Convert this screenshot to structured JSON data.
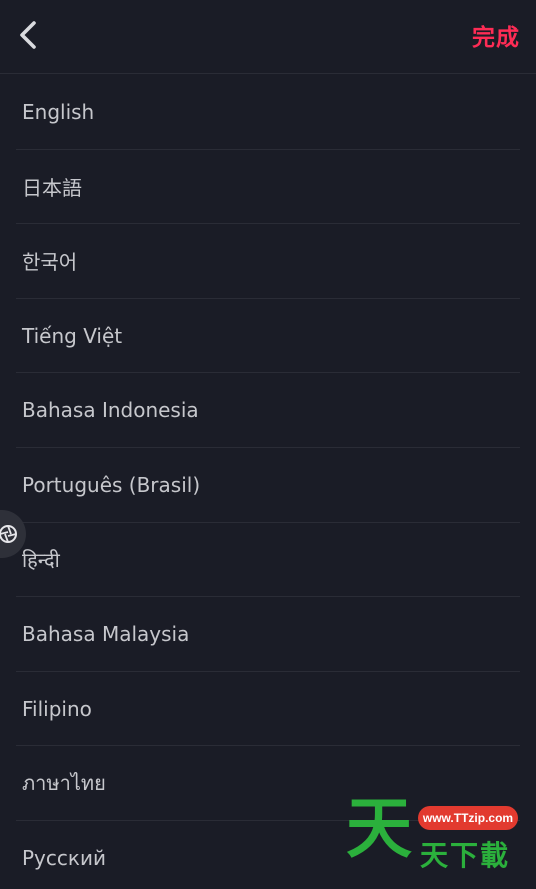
{
  "header": {
    "back_icon": "chevron-left-icon",
    "done_label": "完成",
    "accent_color": "#fe2c55"
  },
  "languages": [
    {
      "label": "English"
    },
    {
      "label": "日本語"
    },
    {
      "label": "한국어"
    },
    {
      "label": "Tiếng Việt"
    },
    {
      "label": "Bahasa Indonesia"
    },
    {
      "label": "Português (Brasil)"
    },
    {
      "label": "हिन्दी"
    },
    {
      "label": "Bahasa Malaysia"
    },
    {
      "label": "Filipino"
    },
    {
      "label": "ภาษาไทย"
    },
    {
      "label": "Русский"
    }
  ],
  "overlay": {
    "floating_handle_icon": "aperture-icon"
  },
  "watermark": {
    "url": "www.TTzip.com",
    "big_char": "天",
    "text": "天下載"
  }
}
